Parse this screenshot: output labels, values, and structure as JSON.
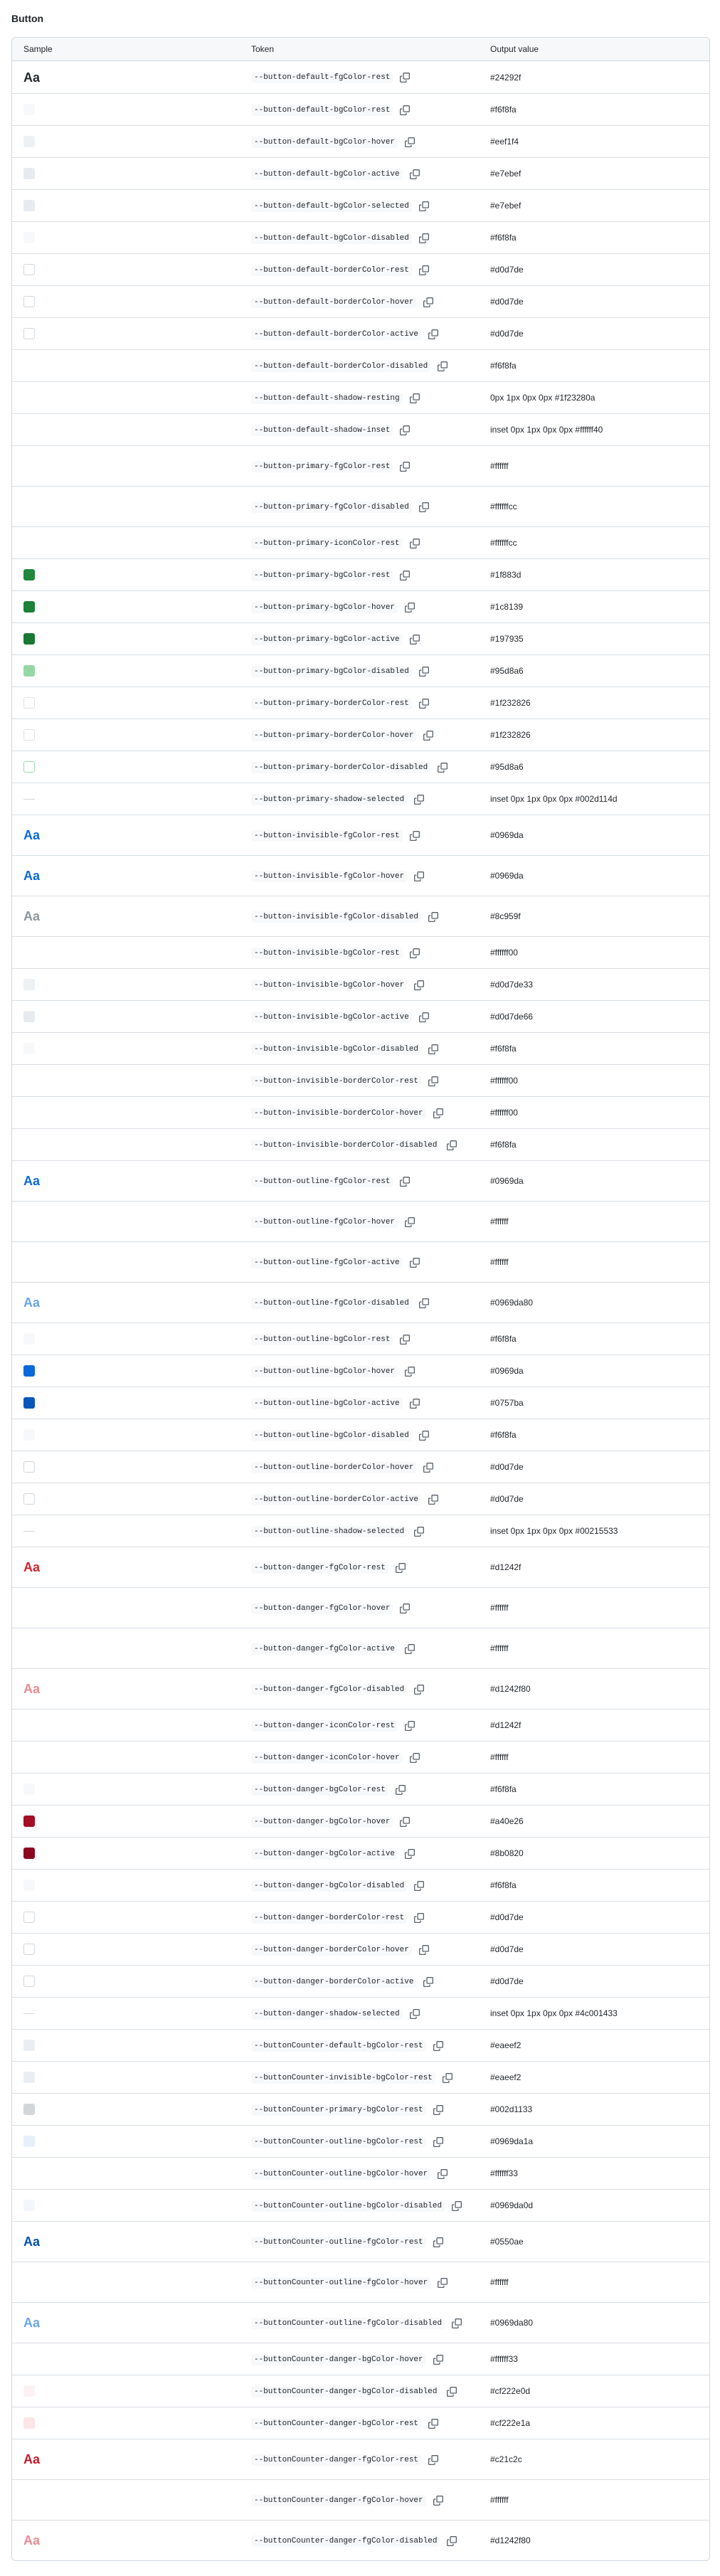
{
  "section_title": "Button",
  "headers": {
    "sample": "Sample",
    "token": "Token",
    "value": "Output value"
  },
  "rows": [
    {
      "h": 45,
      "sample": "text",
      "sample_text": "Aa",
      "color": "#24292f",
      "token": "--button-default-fgColor-rest",
      "value": "#24292f"
    },
    {
      "h": 45,
      "sample": "swatch",
      "fill": "#f6f8fa",
      "border": "#f6f8fa",
      "token": "--button-default-bgColor-rest",
      "value": "#f6f8fa"
    },
    {
      "h": 45,
      "sample": "swatch",
      "fill": "#eef1f4",
      "border": "#eef1f4",
      "token": "--button-default-bgColor-hover",
      "value": "#eef1f4"
    },
    {
      "h": 45,
      "sample": "swatch",
      "fill": "#e7ebef",
      "border": "#e7ebef",
      "token": "--button-default-bgColor-active",
      "value": "#e7ebef"
    },
    {
      "h": 45,
      "sample": "swatch",
      "fill": "#e7ebef",
      "border": "#e7ebef",
      "token": "--button-default-bgColor-selected",
      "value": "#e7ebef"
    },
    {
      "h": 45,
      "sample": "swatch",
      "fill": "#f6f8fa",
      "border": "#f6f8fa",
      "token": "--button-default-bgColor-disabled",
      "value": "#f6f8fa"
    },
    {
      "h": 45,
      "sample": "swatch",
      "fill": "#ffffff",
      "border": "#d0d7de",
      "token": "--button-default-borderColor-rest",
      "value": "#d0d7de"
    },
    {
      "h": 45,
      "sample": "swatch",
      "fill": "#ffffff",
      "border": "#d0d7de",
      "token": "--button-default-borderColor-hover",
      "value": "#d0d7de"
    },
    {
      "h": 45,
      "sample": "swatch",
      "fill": "#ffffff",
      "border": "#d0d7de",
      "token": "--button-default-borderColor-active",
      "value": "#d0d7de"
    },
    {
      "h": 45,
      "sample": "none",
      "token": "--button-default-borderColor-disabled",
      "value": "#f6f8fa"
    },
    {
      "h": 45,
      "sample": "none",
      "token": "--button-default-shadow-resting",
      "value": "0px 1px 0px 0px #1f23280a"
    },
    {
      "h": 45,
      "sample": "none",
      "token": "--button-default-shadow-inset",
      "value": "inset 0px 1px 0px 0px #ffffff40"
    },
    {
      "h": 57,
      "sample": "none",
      "token": "--button-primary-fgColor-rest",
      "value": "#ffffff"
    },
    {
      "h": 57,
      "sample": "none",
      "token": "--button-primary-fgColor-disabled",
      "value": "#ffffffcc"
    },
    {
      "h": 45,
      "sample": "none",
      "token": "--button-primary-iconColor-rest",
      "value": "#ffffffcc"
    },
    {
      "h": 45,
      "sample": "swatch",
      "fill": "#1f883d",
      "border": "#1f883d",
      "token": "--button-primary-bgColor-rest",
      "value": "#1f883d"
    },
    {
      "h": 45,
      "sample": "swatch",
      "fill": "#1c8139",
      "border": "#1c8139",
      "token": "--button-primary-bgColor-hover",
      "value": "#1c8139"
    },
    {
      "h": 45,
      "sample": "swatch",
      "fill": "#197935",
      "border": "#197935",
      "token": "--button-primary-bgColor-active",
      "value": "#197935"
    },
    {
      "h": 45,
      "sample": "swatch",
      "fill": "#95d8a6",
      "border": "#95d8a6",
      "token": "--button-primary-bgColor-disabled",
      "value": "#95d8a6"
    },
    {
      "h": 45,
      "sample": "swatch",
      "fill": "#ffffff",
      "border": "#dfe2e5",
      "token": "--button-primary-borderColor-rest",
      "value": "#1f232826"
    },
    {
      "h": 45,
      "sample": "swatch",
      "fill": "#ffffff",
      "border": "#dfe2e5",
      "token": "--button-primary-borderColor-hover",
      "value": "#1f232826"
    },
    {
      "h": 45,
      "sample": "swatch",
      "fill": "#ffffff",
      "border": "#95d8a6",
      "token": "--button-primary-borderColor-disabled",
      "value": "#95d8a6"
    },
    {
      "h": 45,
      "sample": "line",
      "token": "--button-primary-shadow-selected",
      "value": "inset 0px 1px 0px 0px #002d114d"
    },
    {
      "h": 57,
      "sample": "text",
      "sample_text": "Aa",
      "color": "#0969da",
      "token": "--button-invisible-fgColor-rest",
      "value": "#0969da"
    },
    {
      "h": 57,
      "sample": "text",
      "sample_text": "Aa",
      "color": "#0969da",
      "token": "--button-invisible-fgColor-hover",
      "value": "#0969da"
    },
    {
      "h": 57,
      "sample": "text",
      "sample_text": "Aa",
      "color": "#8c959f",
      "token": "--button-invisible-fgColor-disabled",
      "value": "#8c959f"
    },
    {
      "h": 45,
      "sample": "none",
      "token": "--button-invisible-bgColor-rest",
      "value": "#ffffff00"
    },
    {
      "h": 45,
      "sample": "swatch",
      "fill": "#eef1f4",
      "border": "#eef1f4",
      "token": "--button-invisible-bgColor-hover",
      "value": "#d0d7de33"
    },
    {
      "h": 45,
      "sample": "swatch",
      "fill": "#e7ebef",
      "border": "#e7ebef",
      "token": "--button-invisible-bgColor-active",
      "value": "#d0d7de66"
    },
    {
      "h": 45,
      "sample": "swatch",
      "fill": "#f6f8fa",
      "border": "#f6f8fa",
      "token": "--button-invisible-bgColor-disabled",
      "value": "#f6f8fa"
    },
    {
      "h": 45,
      "sample": "none",
      "token": "--button-invisible-borderColor-rest",
      "value": "#ffffff00"
    },
    {
      "h": 45,
      "sample": "none",
      "token": "--button-invisible-borderColor-hover",
      "value": "#ffffff00"
    },
    {
      "h": 45,
      "sample": "none",
      "token": "--button-invisible-borderColor-disabled",
      "value": "#f6f8fa"
    },
    {
      "h": 57,
      "sample": "text",
      "sample_text": "Aa",
      "color": "#0969da",
      "token": "--button-outline-fgColor-rest",
      "value": "#0969da"
    },
    {
      "h": 57,
      "sample": "none",
      "token": "--button-outline-fgColor-hover",
      "value": "#ffffff"
    },
    {
      "h": 57,
      "sample": "none",
      "token": "--button-outline-fgColor-active",
      "value": "#ffffff"
    },
    {
      "h": 57,
      "sample": "text",
      "sample_text": "Aa",
      "color": "#6aa5e8",
      "token": "--button-outline-fgColor-disabled",
      "value": "#0969da80"
    },
    {
      "h": 45,
      "sample": "swatch",
      "fill": "#f6f8fa",
      "border": "#f6f8fa",
      "token": "--button-outline-bgColor-rest",
      "value": "#f6f8fa"
    },
    {
      "h": 45,
      "sample": "swatch",
      "fill": "#0969da",
      "border": "#0969da",
      "token": "--button-outline-bgColor-hover",
      "value": "#0969da"
    },
    {
      "h": 45,
      "sample": "swatch",
      "fill": "#0757ba",
      "border": "#0757ba",
      "token": "--button-outline-bgColor-active",
      "value": "#0757ba"
    },
    {
      "h": 45,
      "sample": "swatch",
      "fill": "#f6f8fa",
      "border": "#f6f8fa",
      "token": "--button-outline-bgColor-disabled",
      "value": "#f6f8fa"
    },
    {
      "h": 45,
      "sample": "swatch",
      "fill": "#ffffff",
      "border": "#d0d7de",
      "token": "--button-outline-borderColor-hover",
      "value": "#d0d7de"
    },
    {
      "h": 45,
      "sample": "swatch",
      "fill": "#ffffff",
      "border": "#d0d7de",
      "token": "--button-outline-borderColor-active",
      "value": "#d0d7de"
    },
    {
      "h": 45,
      "sample": "line",
      "token": "--button-outline-shadow-selected",
      "value": "inset 0px 1px 0px 0px #00215533"
    },
    {
      "h": 57,
      "sample": "text",
      "sample_text": "Aa",
      "color": "#d1242f",
      "token": "--button-danger-fgColor-rest",
      "value": "#d1242f"
    },
    {
      "h": 57,
      "sample": "none",
      "token": "--button-danger-fgColor-hover",
      "value": "#ffffff"
    },
    {
      "h": 57,
      "sample": "none",
      "token": "--button-danger-fgColor-active",
      "value": "#ffffff"
    },
    {
      "h": 57,
      "sample": "text",
      "sample_text": "Aa",
      "color": "#e88c92",
      "token": "--button-danger-fgColor-disabled",
      "value": "#d1242f80"
    },
    {
      "h": 45,
      "sample": "none",
      "token": "--button-danger-iconColor-rest",
      "value": "#d1242f"
    },
    {
      "h": 45,
      "sample": "none",
      "token": "--button-danger-iconColor-hover",
      "value": "#ffffff"
    },
    {
      "h": 45,
      "sample": "swatch",
      "fill": "#f6f8fa",
      "border": "#f6f8fa",
      "token": "--button-danger-bgColor-rest",
      "value": "#f6f8fa"
    },
    {
      "h": 45,
      "sample": "swatch",
      "fill": "#a40e26",
      "border": "#a40e26",
      "token": "--button-danger-bgColor-hover",
      "value": "#a40e26"
    },
    {
      "h": 45,
      "sample": "swatch",
      "fill": "#8b0820",
      "border": "#8b0820",
      "token": "--button-danger-bgColor-active",
      "value": "#8b0820"
    },
    {
      "h": 45,
      "sample": "swatch",
      "fill": "#f6f8fa",
      "border": "#f6f8fa",
      "token": "--button-danger-bgColor-disabled",
      "value": "#f6f8fa"
    },
    {
      "h": 45,
      "sample": "swatch",
      "fill": "#ffffff",
      "border": "#d0d7de",
      "token": "--button-danger-borderColor-rest",
      "value": "#d0d7de"
    },
    {
      "h": 45,
      "sample": "swatch",
      "fill": "#ffffff",
      "border": "#d0d7de",
      "token": "--button-danger-borderColor-hover",
      "value": "#d0d7de"
    },
    {
      "h": 45,
      "sample": "swatch",
      "fill": "#ffffff",
      "border": "#d0d7de",
      "token": "--button-danger-borderColor-active",
      "value": "#d0d7de"
    },
    {
      "h": 45,
      "sample": "line",
      "token": "--button-danger-shadow-selected",
      "value": "inset 0px 1px 0px 0px #4c001433"
    },
    {
      "h": 45,
      "sample": "swatch",
      "fill": "#eaeef2",
      "border": "#eaeef2",
      "token": "--buttonCounter-default-bgColor-rest",
      "value": "#eaeef2"
    },
    {
      "h": 45,
      "sample": "swatch",
      "fill": "#eaeef2",
      "border": "#eaeef2",
      "token": "--buttonCounter-invisible-bgColor-rest",
      "value": "#eaeef2"
    },
    {
      "h": 45,
      "sample": "swatch",
      "fill": "#d2d6d9",
      "border": "#d2d6d9",
      "token": "--buttonCounter-primary-bgColor-rest",
      "value": "#002d1133"
    },
    {
      "h": 45,
      "sample": "swatch",
      "fill": "#e6f0fb",
      "border": "#e6f0fb",
      "token": "--buttonCounter-outline-bgColor-rest",
      "value": "#0969da1a"
    },
    {
      "h": 45,
      "sample": "none",
      "token": "--buttonCounter-outline-bgColor-hover",
      "value": "#ffffff33"
    },
    {
      "h": 45,
      "sample": "swatch",
      "fill": "#f3f6fb",
      "border": "#f3f6fb",
      "token": "--buttonCounter-outline-bgColor-disabled",
      "value": "#0969da0d"
    },
    {
      "h": 57,
      "sample": "text",
      "sample_text": "Aa",
      "color": "#0550ae",
      "token": "--buttonCounter-outline-fgColor-rest",
      "value": "#0550ae"
    },
    {
      "h": 57,
      "sample": "none",
      "token": "--buttonCounter-outline-fgColor-hover",
      "value": "#ffffff"
    },
    {
      "h": 57,
      "sample": "text",
      "sample_text": "Aa",
      "color": "#6aa5e8",
      "token": "--buttonCounter-outline-fgColor-disabled",
      "value": "#0969da80"
    },
    {
      "h": 45,
      "sample": "none",
      "token": "--buttonCounter-danger-bgColor-hover",
      "value": "#ffffff33"
    },
    {
      "h": 45,
      "sample": "swatch",
      "fill": "#fcf2f3",
      "border": "#fcf2f3",
      "token": "--buttonCounter-danger-bgColor-disabled",
      "value": "#cf222e0d"
    },
    {
      "h": 45,
      "sample": "swatch",
      "fill": "#fbe5e7",
      "border": "#fbe5e7",
      "token": "--buttonCounter-danger-bgColor-rest",
      "value": "#cf222e1a"
    },
    {
      "h": 57,
      "sample": "text",
      "sample_text": "Aa",
      "color": "#c21c2c",
      "token": "--buttonCounter-danger-fgColor-rest",
      "value": "#c21c2c"
    },
    {
      "h": 57,
      "sample": "none",
      "token": "--buttonCounter-danger-fgColor-hover",
      "value": "#ffffff"
    },
    {
      "h": 57,
      "sample": "text",
      "sample_text": "Aa",
      "color": "#e88c92",
      "token": "--buttonCounter-danger-fgColor-disabled",
      "value": "#d1242f80"
    }
  ],
  "icons": {
    "copy": "copy-icon"
  }
}
